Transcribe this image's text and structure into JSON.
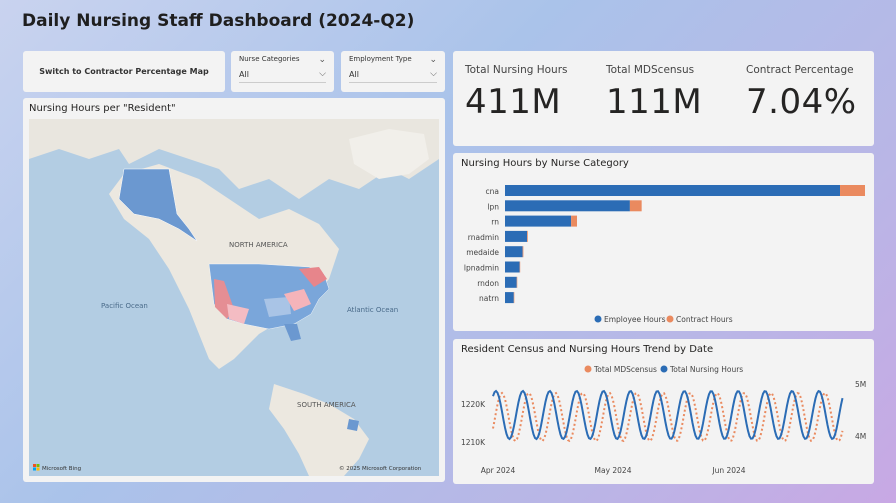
{
  "title": "Daily Nursing Staff Dashboard (2024-Q2)",
  "switch_button": "Switch to Contractor Percentage Map",
  "slicers": [
    {
      "label": "Nurse Categories",
      "value": "All"
    },
    {
      "label": "Employment Type",
      "value": "All"
    }
  ],
  "map": {
    "title": "Nursing Hours per \"Resident\"",
    "labels": {
      "north_america": "NORTH AMERICA",
      "south_america": "SOUTH AMERICA",
      "pacific": "Pacific Ocean",
      "atlantic": "Atlantic Ocean"
    },
    "bing": "Microsoft Bing",
    "copyright": "© 2025 Microsoft Corporation"
  },
  "kpis": [
    {
      "label": "Total Nursing Hours",
      "value": "411M"
    },
    {
      "label": "Total MDScensus",
      "value": "111M"
    },
    {
      "label": "Contract Percentage",
      "value": "7.04%"
    }
  ],
  "colors": {
    "employee": "#2b6cb5",
    "contract": "#ea8a5f"
  },
  "chart_data": [
    {
      "type": "bar",
      "orientation": "horizontal",
      "stacked": true,
      "title": "Nursing Hours by Nurse Category",
      "categories": [
        "cna",
        "lpn",
        "rn",
        "rnadmin",
        "medaide",
        "lpnadmin",
        "rndon",
        "natrn"
      ],
      "series": [
        {
          "name": "Employee Hours",
          "values": [
            228,
            85,
            45,
            15,
            12,
            10,
            8,
            6
          ]
        },
        {
          "name": "Contract Hours",
          "values": [
            17,
            8,
            4,
            0.5,
            0.5,
            0.3,
            0.2,
            0.2
          ]
        }
      ],
      "legend": "bottom"
    },
    {
      "type": "line",
      "title": "Resident Census and Nursing Hours Trend by Date",
      "x_labels": [
        "Apr 2024",
        "May 2024",
        "Jun 2024"
      ],
      "y_left_ticks": [
        "1220K",
        "1210K"
      ],
      "y_right_ticks": [
        "5M",
        "4M"
      ],
      "series": [
        {
          "name": "Total MDScensus",
          "axis": "left",
          "style": "dotted"
        },
        {
          "name": "Total Nursing Hours",
          "axis": "right",
          "style": "solid"
        }
      ],
      "legend": "top"
    }
  ]
}
